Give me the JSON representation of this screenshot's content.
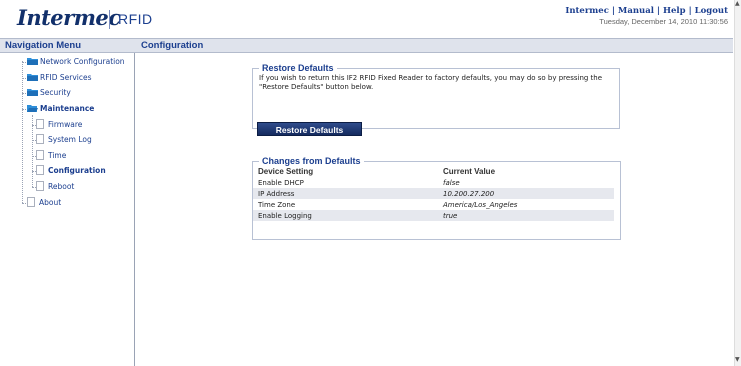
{
  "header": {
    "logo": "Intermec",
    "product": "RFID",
    "links": [
      "Intermec",
      "Manual",
      "Help",
      "Logout"
    ],
    "separator": "|",
    "datetime": "Tuesday, December 14, 2010 11:30:56"
  },
  "nav": {
    "title": "Navigation Menu",
    "items": [
      {
        "label": "Network Configuration"
      },
      {
        "label": "RFID Services"
      },
      {
        "label": "Security"
      },
      {
        "label": "Maintenance"
      },
      {
        "label": "Firmware"
      },
      {
        "label": "System Log"
      },
      {
        "label": "Time"
      },
      {
        "label": "Configuration"
      },
      {
        "label": "Reboot"
      },
      {
        "label": "About"
      }
    ]
  },
  "main": {
    "title": "Configuration",
    "restore": {
      "legend": "Restore Defaults",
      "text": "If you wish to return this IF2 RFID Fixed Reader to factory defaults, you may do so by pressing the \"Restore Defaults\" button below.",
      "button": "Restore Defaults"
    },
    "changes": {
      "legend": "Changes from Defaults",
      "columns": [
        "Device Setting",
        "Current Value"
      ],
      "rows": [
        {
          "setting": "Enable DHCP",
          "value": "false"
        },
        {
          "setting": "IP Address",
          "value": "10.200.27.200"
        },
        {
          "setting": "Time Zone",
          "value": "America/Los_Angeles"
        },
        {
          "setting": "Enable Logging",
          "value": "true"
        }
      ]
    }
  },
  "colors": {
    "brand_blue": "#1c3f8f",
    "bar_bg": "#dfe3ec",
    "button_bg": "#1f3a78"
  },
  "icons": {
    "folder": "folder-icon",
    "page": "page-icon"
  }
}
